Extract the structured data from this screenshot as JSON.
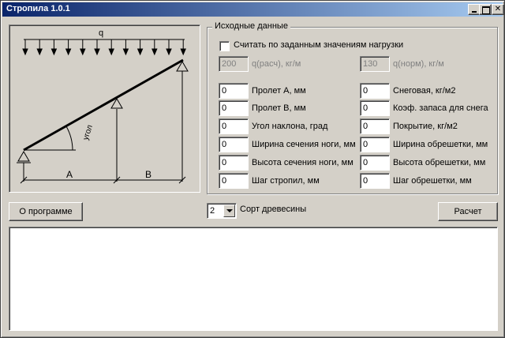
{
  "window": {
    "title": "Стропила 1.0.1"
  },
  "diagram": {
    "load_label": "q",
    "angle_label": "угол",
    "dim_a": "A",
    "dim_b": "B"
  },
  "input_group": {
    "title": "Исходные данные",
    "use_load_checkbox": {
      "label": "Считать по заданным значениям нагрузки",
      "checked": false
    },
    "q_calc": {
      "value": "200",
      "label": "q(расч), кг/м",
      "disabled": true
    },
    "q_norm": {
      "value": "130",
      "label": "q(норм), кг/м",
      "disabled": true
    },
    "left_fields": [
      {
        "value": "0",
        "label": "Пролет А, мм"
      },
      {
        "value": "0",
        "label": "Пролет В, мм"
      },
      {
        "value": "0",
        "label": "Угол наклона, град"
      },
      {
        "value": "0",
        "label": "Ширина сечения ноги, мм"
      },
      {
        "value": "0",
        "label": "Высота сечения ноги, мм"
      },
      {
        "value": "0",
        "label": "Шаг стропил, мм"
      }
    ],
    "right_fields": [
      {
        "value": "0",
        "label": "Снеговая, кг/м2"
      },
      {
        "value": "0",
        "label": "Коэф. запаса для снега"
      },
      {
        "value": "0",
        "label": "Покрытие, кг/м2"
      },
      {
        "value": "0",
        "label": "Ширина обрешетки, мм"
      },
      {
        "value": "0",
        "label": "Высота обрешетки, мм"
      },
      {
        "value": "0",
        "label": "Шаг обрешетки, мм"
      }
    ]
  },
  "about_button": "О программе",
  "wood_grade": {
    "value": "2",
    "label": "Сорт древесины"
  },
  "calc_button": "Расчет",
  "output_text": ""
}
